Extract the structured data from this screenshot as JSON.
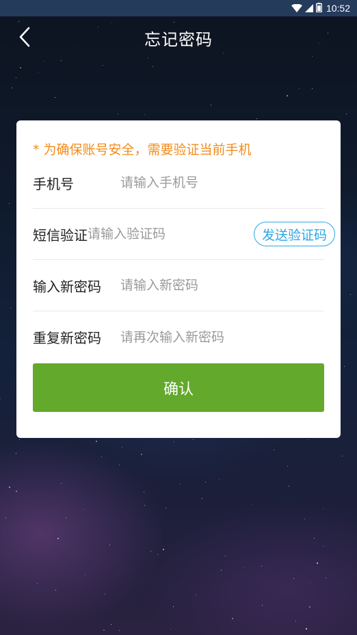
{
  "status_bar": {
    "time": "10:52",
    "icons": [
      "wifi-icon",
      "signal-icon",
      "battery-icon"
    ]
  },
  "header": {
    "title": "忘记密码",
    "back_icon": "chevron-left-icon"
  },
  "form": {
    "notice": "* 为确保账号安全，需要验证当前手机",
    "fields": [
      {
        "label": "手机号",
        "placeholder": "请输入手机号",
        "value": ""
      },
      {
        "label": "短信验证",
        "placeholder": "请输入验证码",
        "value": ""
      },
      {
        "label": "输入新密码",
        "placeholder": "请输入新密码",
        "value": ""
      },
      {
        "label": "重复新密码",
        "placeholder": "请再次输入新密码",
        "value": ""
      }
    ],
    "send_code_label": "发送验证码",
    "confirm_label": "确认"
  },
  "colors": {
    "notice": "#f28c1a",
    "accent_link": "#2aa7e5",
    "confirm_button": "#63a92b",
    "status_bar": "#243b5c"
  }
}
